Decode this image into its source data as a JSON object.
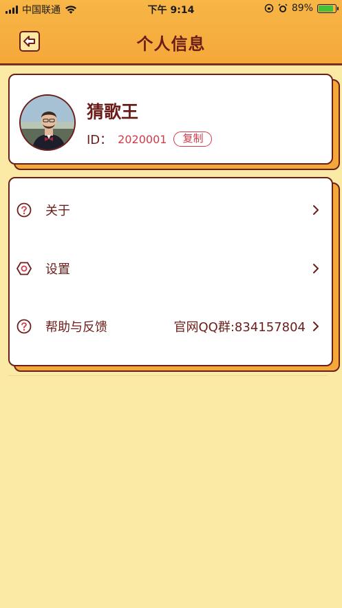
{
  "status_bar": {
    "carrier": "中国联通",
    "time": "下午 9:14",
    "battery_percent": "89%",
    "battery_level": 0.89
  },
  "header": {
    "title": "个人信息",
    "back_icon": "back-arrow-icon"
  },
  "profile": {
    "name": "猜歌王",
    "id_label": "ID：",
    "id_value": "2020001",
    "copy_label": "复制"
  },
  "menu": [
    {
      "label": "关于",
      "icon": "question-circle-icon",
      "value": ""
    },
    {
      "label": "设置",
      "icon": "hex-gear-icon",
      "value": ""
    },
    {
      "label": "帮助与反馈",
      "icon": "question-circle-icon",
      "value": "官网QQ群:834157804"
    }
  ],
  "colors": {
    "header_bg": "#f5a83a",
    "page_bg": "#fbe9a6",
    "dark_brown": "#6b1d1a",
    "accent_red": "#d23a4a"
  }
}
